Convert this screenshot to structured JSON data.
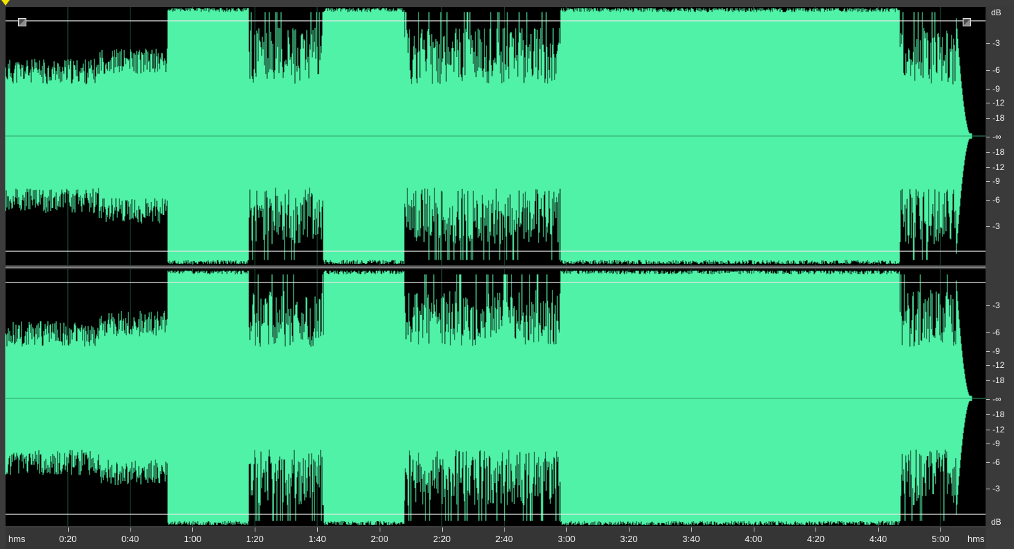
{
  "editor": {
    "colors": {
      "waveform": "#4ff2a6",
      "background": "#000000",
      "grid": "#1e5a3a",
      "envelope": "#e8e8e8",
      "start_marker": "#f4e400"
    },
    "channel_labels": {
      "top_unit": "dB",
      "bottom_unit": "dB"
    },
    "db_scale": {
      "channel1": [
        "-3",
        "-6",
        "-9",
        "-12",
        "-18",
        "-∞",
        "-18",
        "-12",
        "-9",
        "-6",
        "-3"
      ],
      "channel2": [
        "-3",
        "-6",
        "-9",
        "-12",
        "-18",
        "-∞",
        "-18",
        "-12",
        "-9",
        "-6",
        "-3"
      ]
    },
    "time_ruler": {
      "left_unit": "hms",
      "right_unit": "hms",
      "labels": [
        "0:20",
        "0:40",
        "1:00",
        "1:20",
        "1:40",
        "2:00",
        "2:20",
        "2:40",
        "3:00",
        "3:20",
        "3:40",
        "4:00",
        "4:20",
        "4:40",
        "5:00"
      ]
    },
    "waveform_segments": [
      {
        "start": "0:00",
        "end": "0:52",
        "type": "quiet"
      },
      {
        "start": "0:52",
        "end": "1:18",
        "type": "loud"
      },
      {
        "start": "1:18",
        "end": "1:42",
        "type": "medium"
      },
      {
        "start": "1:42",
        "end": "2:08",
        "type": "loud"
      },
      {
        "start": "2:08",
        "end": "2:58",
        "type": "medium"
      },
      {
        "start": "2:58",
        "end": "4:47",
        "type": "loud"
      },
      {
        "start": "4:47",
        "end": "5:05",
        "type": "medium"
      },
      {
        "start": "5:05",
        "end": "5:10",
        "type": "fade"
      }
    ]
  }
}
